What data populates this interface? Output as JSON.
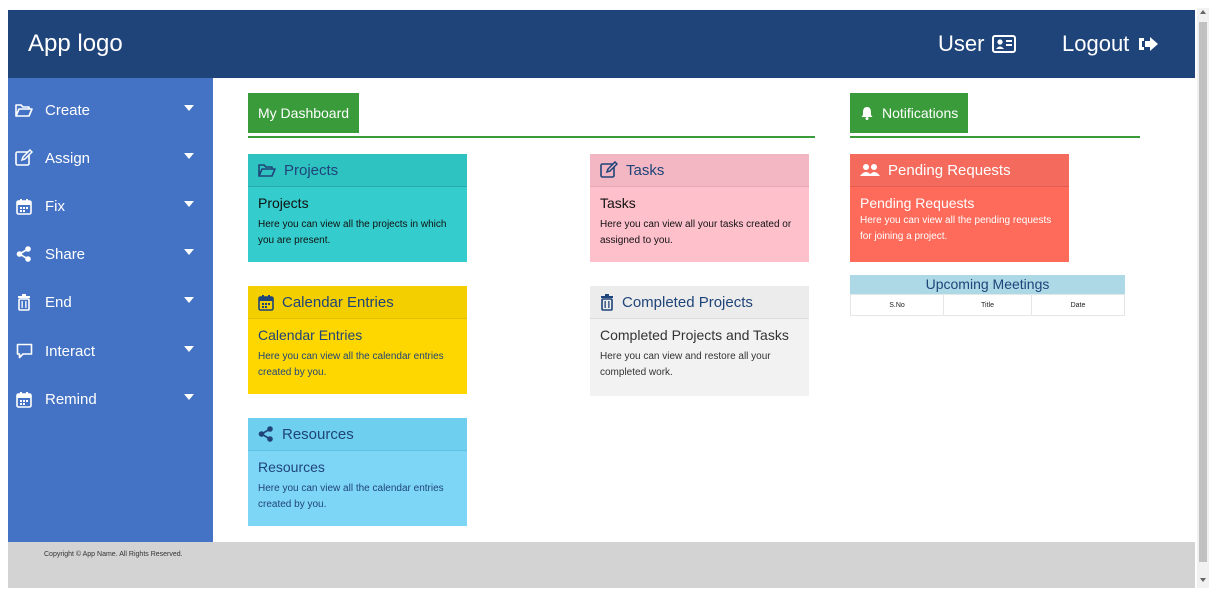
{
  "header": {
    "logo": "App logo",
    "user_label": "User",
    "logout_label": "Logout"
  },
  "sidebar": {
    "items": [
      {
        "label": "Create",
        "icon": "folder-open-icon"
      },
      {
        "label": "Assign",
        "icon": "edit-icon"
      },
      {
        "label": "Fix",
        "icon": "calendar-icon"
      },
      {
        "label": "Share",
        "icon": "share-icon"
      },
      {
        "label": "End",
        "icon": "trash-icon"
      },
      {
        "label": "Interact",
        "icon": "comment-icon"
      },
      {
        "label": "Remind",
        "icon": "calendar-icon"
      }
    ]
  },
  "main": {
    "dashboard_label": "My Dashboard",
    "notifications_label": "Notifications",
    "cards": {
      "projects": {
        "header": "Projects",
        "title": "Projects",
        "text": "Here you can view all the projects in which you are present."
      },
      "tasks": {
        "header": "Tasks",
        "title": "Tasks",
        "text": "Here you can view all your tasks created or assigned to you."
      },
      "pending": {
        "header": "Pending Requests",
        "title": "Pending Requests",
        "text": "Here you can view all the pending requests for joining a project."
      },
      "calendar": {
        "header": "Calendar Entries",
        "title": "Calendar Entries",
        "text": "Here you can view all the calendar entries created by you."
      },
      "completed": {
        "header": "Completed Projects",
        "title": "Completed Projects and Tasks",
        "text": "Here you can view and restore all your completed work."
      },
      "resources": {
        "header": "Resources",
        "title": "Resources",
        "text": "Here you can view all the calendar entries created by you."
      }
    },
    "meetings": {
      "title": "Upcoming Meetings",
      "columns": [
        "S.No",
        "Title",
        "Date"
      ]
    }
  },
  "footer": {
    "copyright": "Copyright © App Name. All Rights Reserved."
  },
  "colors": {
    "header": "#1f4479",
    "sidebar": "#4472c4",
    "green": "#3a9b3a",
    "teal": "#34cccc",
    "pink": "#fec0cb",
    "red": "#ff6b5b",
    "yellow": "#ffd700",
    "grey": "#f2f2f2",
    "blue": "#7dd6f5"
  }
}
